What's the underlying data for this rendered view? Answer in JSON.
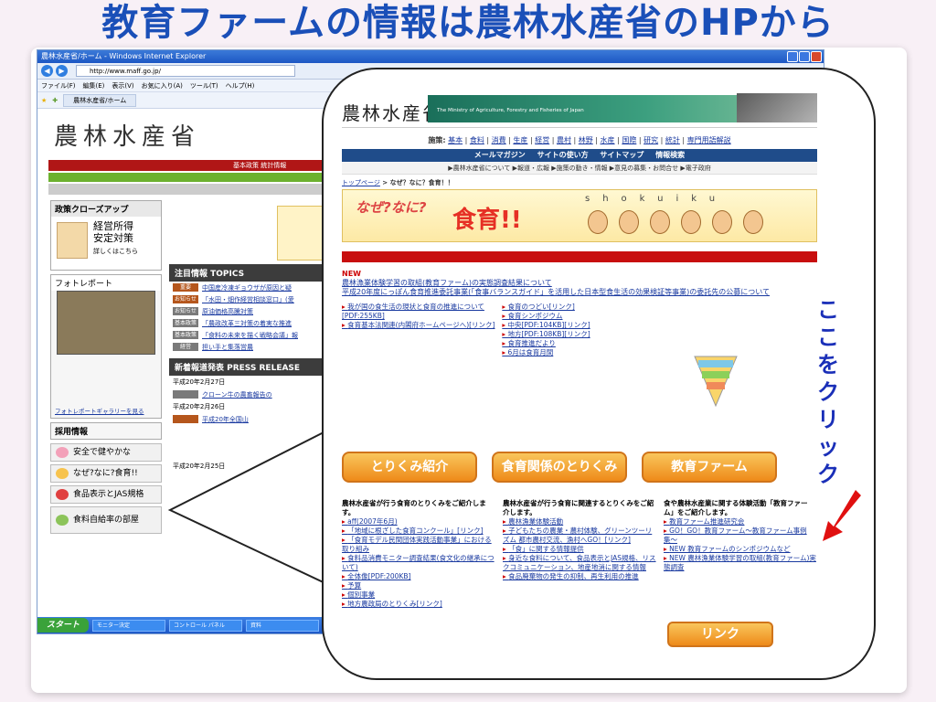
{
  "slide": {
    "title": "教育ファームの情報は農林水産省のHPから"
  },
  "browser": {
    "window_title": "農林水産省/ホーム - Windows Internet Explorer",
    "url": "http://www.maff.go.jp/",
    "menu": [
      "ファイル(F)",
      "編集(E)",
      "表示(V)",
      "お気に入り(A)",
      "ツール(T)",
      "ヘルプ(H)"
    ],
    "tab_label": "農林水産省/ホーム"
  },
  "page": {
    "site_title": "農林水産省",
    "redbar_labels": "基本政策 統計情報",
    "closeup": {
      "head": "政策クローズアップ",
      "line1": "経営所得",
      "line2": "安定対策",
      "more": "詳しくはこちら"
    },
    "photo_report": "フォトレポート",
    "photo_caption": "",
    "photo_gallery": "フォトレポートギャラリーを見る",
    "recruit": "採用情報",
    "side_buttons": [
      "安全で健やかな",
      "なぜ?なに?食育!!",
      "食品表示とJAS規格",
      "食料自給率の部屋"
    ],
    "topics_head": "注目情報 TOPICS",
    "topics": [
      {
        "tag": "重要",
        "text": "中国産冷凍ギョウザが原因と疑"
      },
      {
        "tag": "お知らせ",
        "text": "「水田・畑作経営相談窓口」(愛"
      },
      {
        "tag": "お知らせ",
        "text": "原油価格高騰対策"
      },
      {
        "tag": "基本政策",
        "text": "「農政改革三対策の着実な推進"
      },
      {
        "tag": "基本政策",
        "text": "「食料の未来を描く戦略会議」報"
      },
      {
        "tag": "経営",
        "text": "担い手と集落営農"
      }
    ],
    "news_head": "新着報道発表 PRESS RELEASE",
    "news_dates": [
      "平成20年2月27日",
      "平成20年2月26日",
      "平成20年2月25日"
    ],
    "news_items": [
      "クローン牛の農畜報告の",
      "平成20年全国山"
    ]
  },
  "taskbar": {
    "start": "スタート",
    "tasks": [
      "モニター決定",
      "コントロール パネル",
      "資料"
    ]
  },
  "zoom": {
    "site_name": "農林水産省",
    "site_en": "The Ministry of Agriculture, Forestry and Fisheries of Japan",
    "nav_prefix": "施策:",
    "nav_links": [
      "基本",
      "食料",
      "消費",
      "生産",
      "経営",
      "農村",
      "林野",
      "水産",
      "国際",
      "研究",
      "統計",
      "専門用語解説"
    ],
    "bluebar": [
      "メールマガジン",
      "サイトの使い方",
      "サイトマップ",
      "情報検索"
    ],
    "subnav": "▶農林水産省について ▶報道・広報 ▶施策の動き・情報 ▶意見の募集・お問合せ ▶電子政府",
    "crumb_top": "トップページ",
    "crumb_rest": " > なぜ？なに？食育！！",
    "banner_naze": "なぜ?なに?",
    "banner_shokuiku": "食育!!",
    "banner_letters": "shokuiku",
    "news_tag": "NEW",
    "news_lines": [
      "農林漁業体験学習の取組(教育ファーム)の実態調査結果について",
      "平成20年度にっぽん食育推進委託事業(「食事バランスガイド」を活用した日本型食生活の効果検証等事業)の委託先の公募について"
    ],
    "col1": [
      "我が国の食生活の現状と食育の推進について[PDF:255KB]",
      "食育基本法関連(内閣府ホームページへ)[リンク]"
    ],
    "col2": [
      "食育のつどい[リンク]",
      "食育シンポジウム",
      "中央[PDF:104KB][リンク]",
      "地方[PDF:108KB][リンク]",
      "食育推進だより",
      "6月は食育月間"
    ],
    "btn1": "とりくみ紹介",
    "btn2": "食育関係のとりくみ",
    "btn3": "教育ファーム",
    "low1": [
      "農林水産省が行う食育のとりくみをご紹介します。",
      "aff(2007年6月)",
      "「地域に根ざした食育コンクール」[リンク]",
      "「食育モデル民間団体実践活動事業」における取り組み",
      "食料品消費モニター調査結果(食文化の継承について)",
      "全体像[PDF:200KB]",
      "予算",
      "個別事業",
      "地方農政局のとりくみ[リンク]"
    ],
    "low2": [
      "農林水産省が行う食育に関連するとりくみをご紹介します。",
      "農林漁業体験活動",
      "子どもたちの農業・農村体験、グリーンツーリズム 都市農村交流、漁村へGO！[リンク]",
      "「食」に関する情報提供",
      "身近な食料について、食品表示とJAS規格、リスクコミュニケーション、地産地消に関する情報",
      "食品廃棄物の発生の抑制、再生利用の推進"
    ],
    "low3": [
      "食や農林水産業に関する体験活動「教育ファーム」をご紹介します。",
      "教育ファーム推進研究会",
      "GO！GO！教育ファーム〜教育ファーム事例集〜",
      "NEW 教育ファームのシンポジウムなど",
      "NEW 農林漁業体験学習の取組(教育ファーム)実態調査"
    ],
    "link_btn": "リンク"
  },
  "annotation": {
    "vertical_text": "ここをクリック",
    "arrow_color": "#e01010"
  }
}
